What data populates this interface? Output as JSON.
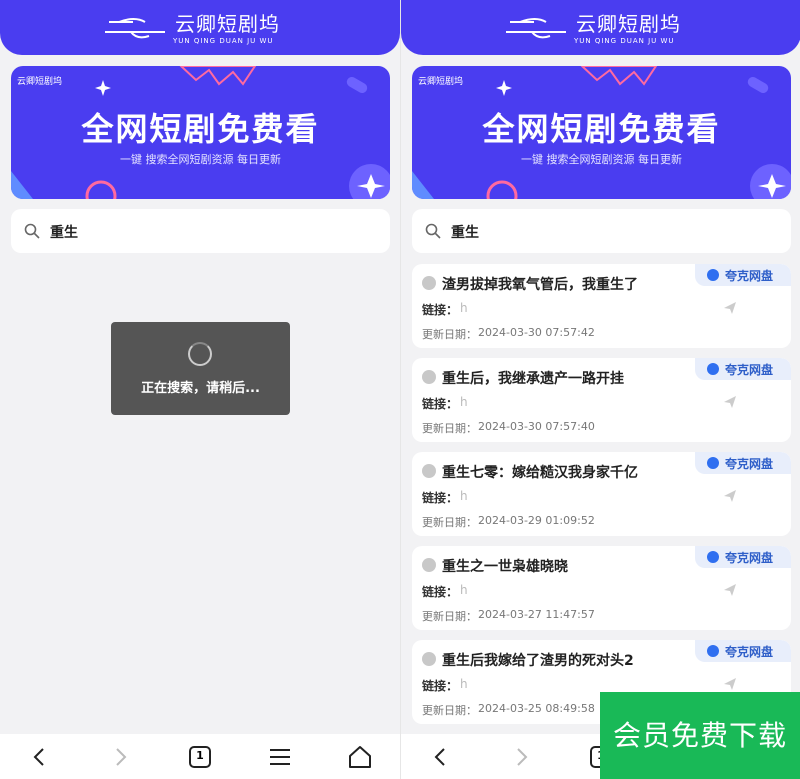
{
  "header": {
    "logo_main": "云卿短剧坞",
    "logo_sub": "YUN QING DUAN JU WU"
  },
  "banner": {
    "logo": "云卿短剧坞",
    "title": "全网短剧免费看",
    "subtitle": "一键 搜索全网短剧资源 每日更新"
  },
  "search": {
    "query": "重生",
    "icon": "search-icon"
  },
  "toast": {
    "text": "正在搜索，请稍后..."
  },
  "results": {
    "link_label": "链接：",
    "date_label": "更新日期：",
    "badge_label": "夸克网盘",
    "items": [
      {
        "title": "渣男拔掉我氧气管后，我重生了",
        "link": "h",
        "date": "2024-03-30 07:57:42"
      },
      {
        "title": "重生后，我继承遗产一路开挂",
        "link": "h",
        "date": "2024-03-30 07:57:40"
      },
      {
        "title": "重生七零：嫁给糙汉我身家千亿",
        "link": "h",
        "date": "2024-03-29 01:09:52"
      },
      {
        "title": "重生之一世枭雄晓晓",
        "link": "h",
        "date": "2024-03-27 11:47:57"
      },
      {
        "title": "重生后我嫁给了渣男的死对头2",
        "link": "h",
        "date": "2024-03-25 08:49:58"
      }
    ]
  },
  "navbar": {
    "tab_count": "1",
    "icons": [
      "back-icon",
      "forward-icon",
      "tabs-icon",
      "menu-icon",
      "home-icon"
    ]
  },
  "promo": {
    "text": "会员免费下载"
  },
  "colors": {
    "brand": "#4a3df0",
    "promo": "#19b957",
    "badge": "#2f5fc9"
  }
}
